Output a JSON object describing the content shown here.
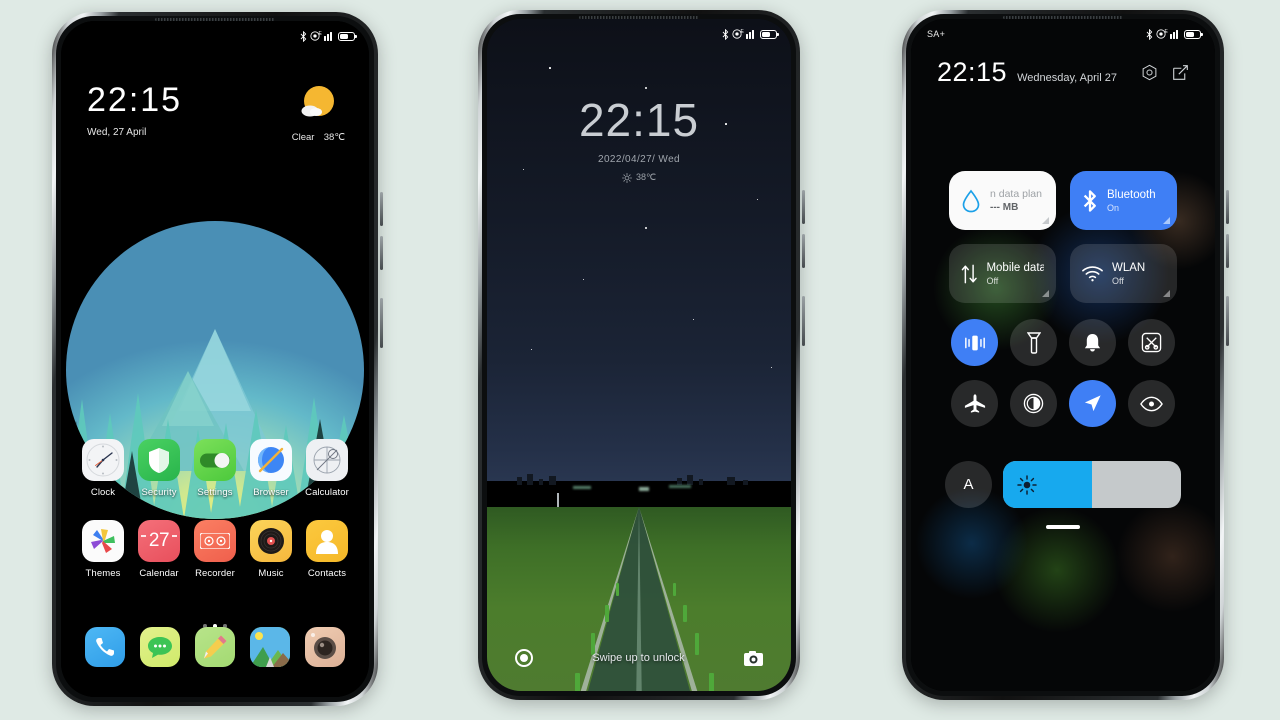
{
  "background_color": "#dfeae5",
  "phone1": {
    "name": "home-screen",
    "statusbar": {
      "left": "",
      "icons": [
        "bluetooth-icon",
        "alarm-circle-icon",
        "signal-e-icon",
        "battery-icon"
      ]
    },
    "clock": {
      "time": "22:15",
      "date": "Wed, 27 April"
    },
    "weather": {
      "condition": "Clear",
      "temperature": "38℃",
      "icon": "sun-cloud-icon"
    },
    "apps": [
      {
        "label": "Clock",
        "icon": "clock-icon"
      },
      {
        "label": "Security",
        "icon": "shield-icon"
      },
      {
        "label": "Settings",
        "icon": "toggle-icon"
      },
      {
        "label": "Browser",
        "icon": "browser-icon"
      },
      {
        "label": "Calculator",
        "icon": "calculator-icon"
      },
      {
        "label": "Themes",
        "icon": "themes-icon"
      },
      {
        "label": "Calendar",
        "icon": "calendar-icon",
        "day": "27"
      },
      {
        "label": "Recorder",
        "icon": "recorder-icon"
      },
      {
        "label": "Music",
        "icon": "music-icon"
      },
      {
        "label": "Contacts",
        "icon": "contacts-icon"
      }
    ],
    "dock": [
      {
        "label": "Phone",
        "icon": "phone-icon"
      },
      {
        "label": "Messages",
        "icon": "messages-icon"
      },
      {
        "label": "Notes",
        "icon": "notes-pencil-icon"
      },
      {
        "label": "Gallery",
        "icon": "gallery-icon"
      },
      {
        "label": "Camera",
        "icon": "camera-icon"
      }
    ],
    "page_indicator": {
      "pages": 3,
      "active": 2
    }
  },
  "phone2": {
    "name": "lock-screen",
    "statusbar": {
      "icons": [
        "bluetooth-icon",
        "alarm-circle-icon",
        "signal-e-icon",
        "battery-icon"
      ]
    },
    "clock": {
      "time": "22:15",
      "date": "2022/04/27/  Wed"
    },
    "weather": {
      "temperature": "38℃",
      "icon": "sun-icon"
    },
    "hint": "Swipe up to unlock",
    "left_shortcut": "flashlight-icon",
    "right_shortcut": "camera-icon"
  },
  "phone3": {
    "name": "control-center",
    "statusbar": {
      "left": "SA+",
      "icons": [
        "bluetooth-icon",
        "alarm-circle-icon",
        "signal-e-icon",
        "battery-icon"
      ]
    },
    "header": {
      "time": "22:15",
      "date": "Wednesday, April 27",
      "actions": [
        "settings-hex-icon",
        "edit-icon"
      ]
    },
    "tiles": [
      {
        "title": "n data plan",
        "subtitle": "--- MB",
        "icon": "data-drop-icon",
        "style": "white",
        "state": "info"
      },
      {
        "title": "Bluetooth",
        "subtitle": "On",
        "icon": "bluetooth-icon",
        "style": "blue",
        "state": "on"
      },
      {
        "title": "Mobile data",
        "subtitle": "Off",
        "icon": "mobile-data-icon",
        "style": "glass",
        "state": "off"
      },
      {
        "title": "WLAN",
        "subtitle": "Off",
        "icon": "wifi-icon",
        "style": "glass",
        "state": "off"
      }
    ],
    "toggles": [
      {
        "name": "vibrate",
        "icon": "vibrate-icon",
        "on": true
      },
      {
        "name": "flashlight",
        "icon": "flashlight-icon",
        "on": false
      },
      {
        "name": "ringer",
        "icon": "bell-icon",
        "on": false
      },
      {
        "name": "screenshot",
        "icon": "scissors-screenshot-icon",
        "on": false
      },
      {
        "name": "airplane-mode",
        "icon": "airplane-icon",
        "on": false
      },
      {
        "name": "dark-mode",
        "icon": "contrast-icon",
        "on": false
      },
      {
        "name": "location",
        "icon": "location-arrow-icon",
        "on": true
      },
      {
        "name": "reading-mode",
        "icon": "eye-icon",
        "on": false
      }
    ],
    "brightness": {
      "auto_label": "A",
      "value": 50,
      "icon": "brightness-sun-icon"
    }
  }
}
